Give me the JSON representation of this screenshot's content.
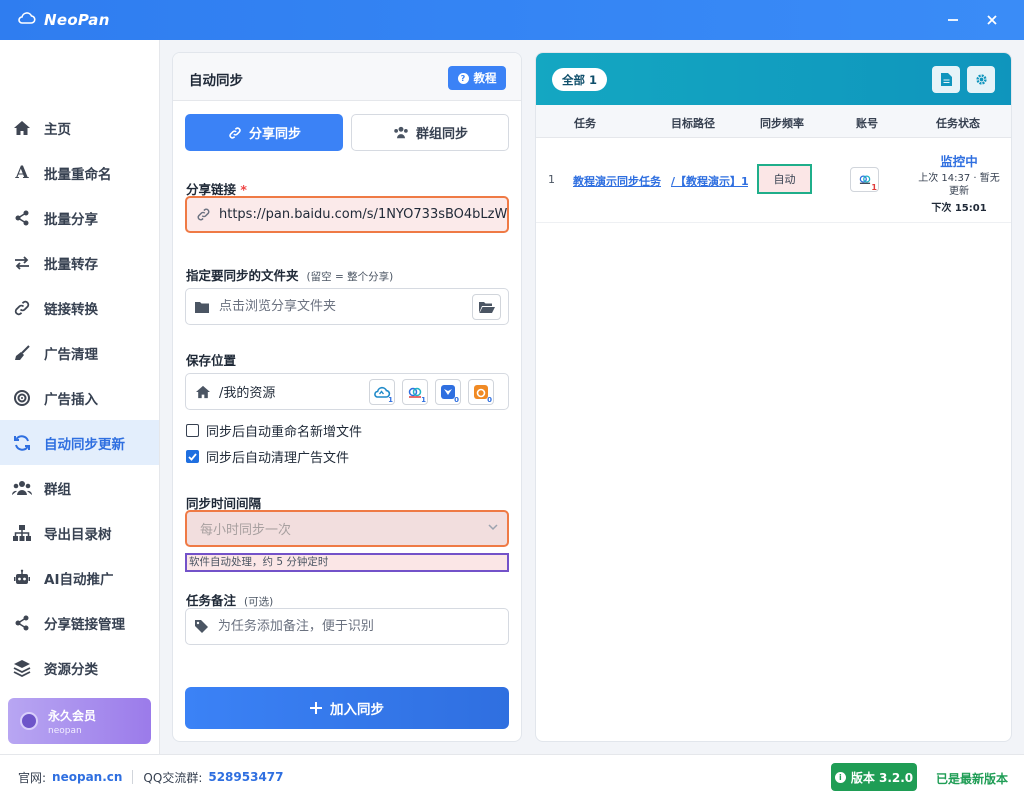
{
  "app": {
    "name": "NeoPan"
  },
  "colors": {
    "primary": "#3b82f6",
    "titlebar": "#2f7df0",
    "accent_teal": "#14a7c2",
    "success": "#1f9d55",
    "highlight_orange": "#ef7a45",
    "highlight_purple": "#7352c9",
    "highlight_green": "#1fae8a"
  },
  "sidebar": {
    "items": [
      {
        "label": "主页",
        "icon": "home-icon"
      },
      {
        "label": "批量重命名",
        "icon": "letter-a-icon"
      },
      {
        "label": "批量分享",
        "icon": "share-icon"
      },
      {
        "label": "批量转存",
        "icon": "swap-arrows-icon"
      },
      {
        "label": "链接转换",
        "icon": "link-icon"
      },
      {
        "label": "广告清理",
        "icon": "broom-icon"
      },
      {
        "label": "广告插入",
        "icon": "target-icon"
      },
      {
        "label": "自动同步更新",
        "icon": "sync-icon",
        "active": true
      },
      {
        "label": "群组",
        "icon": "users-icon"
      },
      {
        "label": "导出目录树",
        "icon": "sitemap-icon"
      },
      {
        "label": "AI自动推广",
        "icon": "robot-icon"
      },
      {
        "label": "分享链接管理",
        "icon": "share-icon"
      },
      {
        "label": "资源分类",
        "icon": "layers-icon"
      }
    ],
    "vip": {
      "title": "永久会员",
      "subtitle": "neopan"
    }
  },
  "form": {
    "title": "自动同步",
    "help_label": "教程",
    "tabs": [
      {
        "label": "分享同步"
      },
      {
        "label": "群组同步"
      }
    ],
    "share_link": {
      "label": "分享链接",
      "required_mark": "*",
      "value": "https://pan.baidu.com/s/1NYO733sBO4bLzW"
    },
    "folder": {
      "label": "指定要同步的文件夹",
      "hint": "(留空 = 整个分享)",
      "placeholder": "点击浏览分享文件夹"
    },
    "save": {
      "label": "保存位置",
      "path": "/我的资源",
      "clouds": [
        {
          "icon": "cloud-a-icon",
          "count": "1"
        },
        {
          "icon": "baidu-cloud-icon",
          "count": "1"
        },
        {
          "icon": "bird-cloud-icon",
          "count": "0"
        },
        {
          "icon": "uc-cloud-icon",
          "count": "0"
        }
      ]
    },
    "options": [
      {
        "label": "同步后自动重命名新增文件",
        "checked": false
      },
      {
        "label": "同步后自动清理广告文件",
        "checked": true
      }
    ],
    "interval": {
      "label": "同步时间间隔",
      "selected": "每小时同步一次",
      "note": "软件自动处理，约 5 分钟定时"
    },
    "remark": {
      "label": "任务备注",
      "hint": "(可选)",
      "placeholder": "为任务添加备注，便于识别"
    },
    "submit_label": "加入同步"
  },
  "tasks": {
    "filter_label": "全部 1",
    "columns": [
      "任务",
      "目标路径",
      "同步频率",
      "账号",
      "任务状态"
    ],
    "rows": [
      {
        "index": "1",
        "name": "教程演示同步任务",
        "path": "/【教程演示】1",
        "frequency": "自动",
        "account_count": "1",
        "status": "监控中",
        "last": "上次 14:37 · 暂无更新",
        "next": "下次 15:01"
      }
    ]
  },
  "footer": {
    "site_label": "官网:",
    "site": "neopan.cn",
    "qq_label": "QQ交流群:",
    "qq": "528953477",
    "version_label": "版本 3.2.0",
    "version_status": "已是最新版本"
  }
}
